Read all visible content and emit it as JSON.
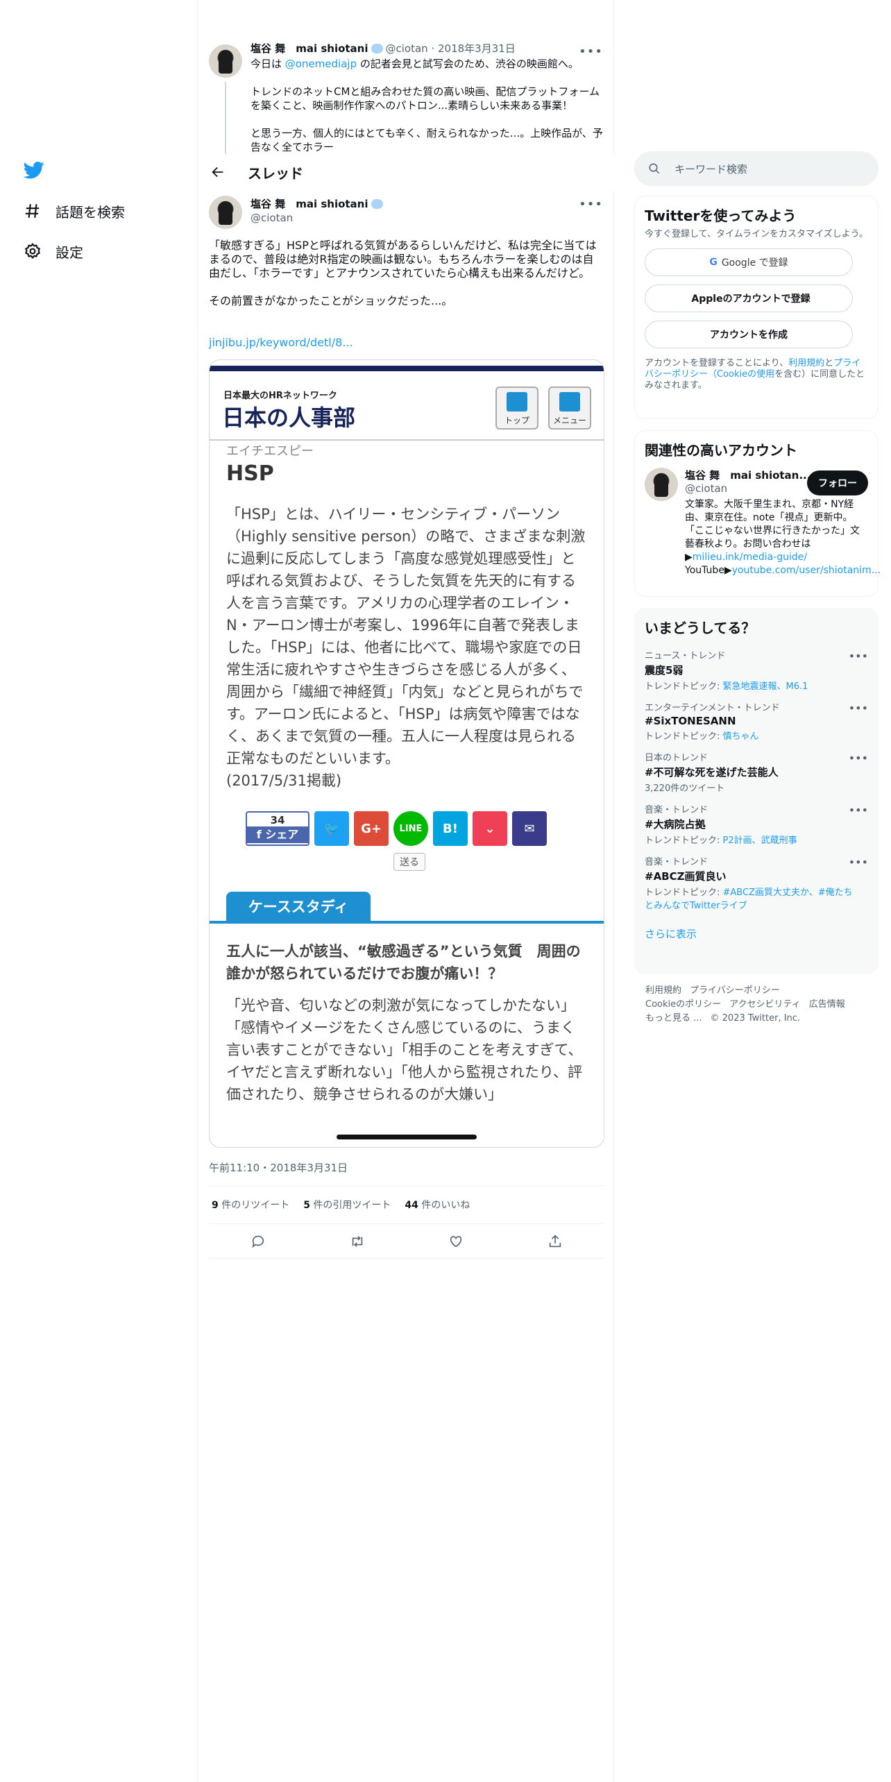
{
  "nav": {
    "explore_label": "話題を検索",
    "settings_label": "設定"
  },
  "prev_tweet": {
    "name": "塩谷 舞　mai shiotani",
    "handle": "@ciotan",
    "date": "2018年3月31日",
    "line1_pre": "今日は ",
    "line1_mention": "@onemediajp",
    "line1_post": " の記者会見と試写会のため、渋谷の映画館へ。",
    "para2": "トレンドのネットCMと組み合わせた質の高い映画、配信プラットフォームを築くこと、映画制作作家へのパトロン...素晴らしい未来ある事業！",
    "para3": "と思う一方、個人的にはとても辛く、耐えられなかった...。上映作品が、予告なく全てホラー"
  },
  "header": {
    "title": "スレッド"
  },
  "tweet": {
    "name": "塩谷 舞　mai shiotani",
    "handle": "@ciotan",
    "para1": "「敏感すぎる」HSPと呼ばれる気質があるらしいんだけど、私は完全に当てはまるので、普段は絶対R指定の映画は観ない。もちろんホラーを楽しむのは自由だし、「ホラーです」とアナウンスされていたら心構えも出来るんだけど。",
    "para2": "その前置きがなかったことがショックだった...。",
    "link": "jinjibu.jp/keyword/detl/8...",
    "timestamp": "午前11:10・2018年3月31日",
    "retweets_num": "9",
    "retweets_label": "件のリツイート",
    "quotes_num": "5",
    "quotes_label": "件の引用ツイート",
    "likes_num": "44",
    "likes_label": "件のいいね"
  },
  "card": {
    "site_sub": "日本最大のHRネットワーク",
    "site_name": "日本の人事部",
    "btn_top": "トップ",
    "btn_menu": "メニュー",
    "kana": "エイチエスピー",
    "title": "HSP",
    "desc": "「HSP」とは、ハイリー・センシティブ・パーソン（Highly sensitive person）の略で、さまざまな刺激に過剰に反応してしまう「高度な感覚処理感受性」と呼ばれる気質および、そうした気質を先天的に有する人を言う言葉です。アメリカの心理学者のエレイン・N・アーロン博士が考案し、1996年に自著で発表しました。「HSP」には、他者に比べて、職場や家庭での日常生活に疲れやすさや生きづらさを感じる人が多く、周囲から「繊細で神経質」「内気」などと見られがちです。アーロン氏によると、「HSP」は病気や障害ではなく、あくまで気質の一種。五人に一人程度は見られる正常なものだといいます。",
    "date_note": "(2017/5/31掲載)",
    "share_count": "34",
    "share_label": "シェア",
    "send_label": "送る",
    "case_label": "ケーススタディ",
    "case_title": "五人に一人が該当、“敏感過ぎる”という気質　周囲の誰かが怒られているだけでお腹が痛い！？",
    "quotes": "「光や音、匂いなどの刺激が気になってしかたない」「感情やイメージをたくさん感じているのに、うまく言い表すことができない」「相手のことを考えすぎて、イヤだと言えず断れない」「他人から監視されたり、評価されたり、競争させられるのが大嫌い」"
  },
  "search": {
    "placeholder": "キーワード検索"
  },
  "signup": {
    "title": "Twitterを使ってみよう",
    "sub": "今すぐ登録して、タイムラインをカスタマイズしよう。",
    "google": "Google で登録",
    "apple": "Appleのアカウントで登録",
    "create": "アカウントを作成",
    "terms_pre": "アカウントを登録することにより、",
    "terms_link1": "利用規約",
    "terms_mid": "と",
    "terms_link2": "プライバシーポリシー（Cookieの使用",
    "terms_post": "を含む）に同意したとみなされます。"
  },
  "related": {
    "title": "関連性の高いアカウント",
    "name": "塩谷 舞　mai shiotan...",
    "handle": "@ciotan",
    "follow": "フォロー",
    "bio": "文筆家。大阪千里生まれ、京都・NY経由、東京在住。note「視点」更新中。「ここじゃない世界に行きたかった」文藝春秋より。お問い合わせは▶",
    "bio_link1": "milieu.ink/media-guide/",
    "bio_mid": " YouTube▶",
    "bio_link2": "youtube.com/user/shiotanim..."
  },
  "trends": {
    "title": "いまどうしてる？",
    "items": [
      {
        "cat": "ニュース・トレンド",
        "name": "震度5弱",
        "desc_pre": "トレンドトピック: ",
        "desc_link": "緊急地震速報、M6.1"
      },
      {
        "cat": "エンターテインメント・トレンド",
        "name": "#SixTONESANN",
        "desc_pre": "トレンドトピック: ",
        "desc_link": "慎ちゃん"
      },
      {
        "cat": "日本のトレンド",
        "name": "#不可解な死を遂げた芸能人",
        "desc_pre": "3,220件のツイート",
        "desc_link": ""
      },
      {
        "cat": "音楽・トレンド",
        "name": "#大病院占拠",
        "desc_pre": "トレンドトピック: ",
        "desc_link": "P2計画、武蔵刑事"
      },
      {
        "cat": "音楽・トレンド",
        "name": "#ABCZ画質良い",
        "desc_pre": "トレンドトピック: ",
        "desc_link": "#ABCZ画質大丈夫か、#俺たちとみんなでTwitterライブ"
      }
    ],
    "more": "さらに表示"
  },
  "footer": {
    "terms": "利用規約",
    "privacy": "プライバシーポリシー",
    "cookie": "Cookieのポリシー",
    "access": "アクセシビリティ",
    "ads": "広告情報",
    "more": "もっと見る ...",
    "copy": "© 2023 Twitter, Inc."
  },
  "colors": {
    "accent": "#1d9bf0",
    "card_navy": "#16235a",
    "card_blue": "#1e8fd1"
  }
}
